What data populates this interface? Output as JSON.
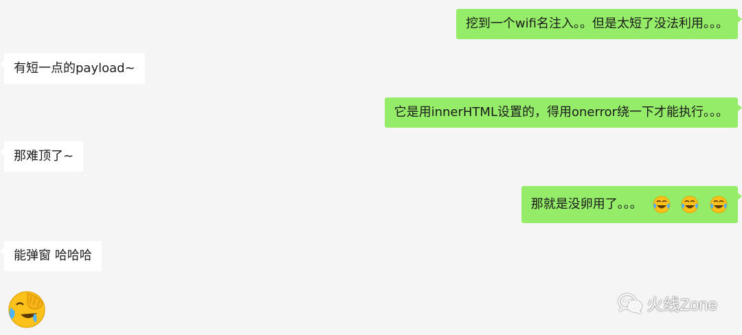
{
  "messages": [
    {
      "side": "right",
      "text": "挖到一个wifi名注入。。但是太短了没法利用。。。"
    },
    {
      "side": "left",
      "text": "有短一点的payload~"
    },
    {
      "side": "right",
      "text": "它是用innerHTML设置的，得用onerror绕一下才能执行。。。"
    },
    {
      "side": "left",
      "text": "那难顶了~"
    },
    {
      "side": "right",
      "text": "那就是没卵用了。。。",
      "emojis": [
        "laugh-cry-icon",
        "laugh-cry-icon",
        "laugh-cry-icon"
      ]
    },
    {
      "side": "left",
      "text": "能弹窗 哈哈哈"
    }
  ],
  "sticker": {
    "icon": "face-palm-laugh-sticker"
  },
  "watermark": {
    "brand": "火线Zone",
    "icon": "wechat-icon"
  },
  "colors": {
    "background": "#f5f5f5",
    "bubble_self": "#95ec69",
    "bubble_other": "#ffffff"
  }
}
